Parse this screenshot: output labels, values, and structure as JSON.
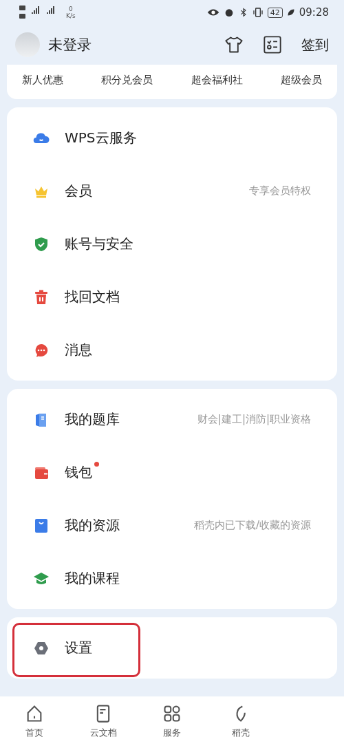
{
  "status_bar": {
    "speed_value": "0",
    "speed_unit": "K/s",
    "battery": "42",
    "time": "09:28"
  },
  "header": {
    "user_name": "未登录",
    "checkin": "签到"
  },
  "quick_links": [
    "新人优惠",
    "积分兑会员",
    "超会福利社",
    "超级会员"
  ],
  "menu_groups": [
    {
      "items": [
        {
          "label": "WPS云服务"
        },
        {
          "label": "会员",
          "hint": "专享会员特权"
        },
        {
          "label": "账号与安全"
        },
        {
          "label": "找回文档"
        },
        {
          "label": "消息"
        }
      ]
    },
    {
      "items": [
        {
          "label": "我的题库",
          "hint": "财会|建工|消防|职业资格"
        },
        {
          "label": "钱包",
          "badge": true
        },
        {
          "label": "我的资源",
          "hint": "稻壳内已下载/收藏的资源"
        },
        {
          "label": "我的课程"
        }
      ]
    },
    {
      "items": [
        {
          "label": "设置",
          "highlighted": true
        }
      ]
    }
  ],
  "tab_bar": [
    {
      "label": "首页"
    },
    {
      "label": "云文档"
    },
    {
      "label": "服务"
    },
    {
      "label": "稻壳"
    }
  ]
}
